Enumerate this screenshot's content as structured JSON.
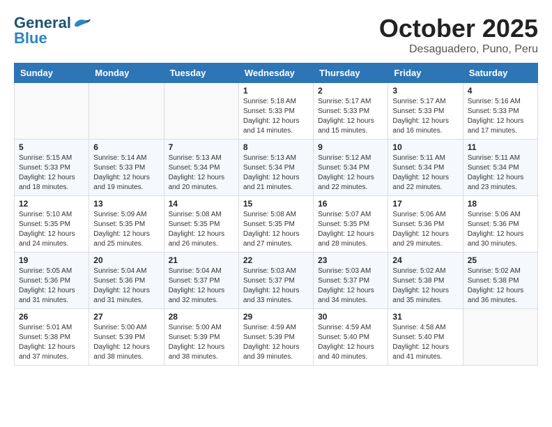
{
  "header": {
    "logo_line1": "General",
    "logo_line2": "Blue",
    "month_title": "October 2025",
    "subtitle": "Desaguadero, Puno, Peru"
  },
  "weekdays": [
    "Sunday",
    "Monday",
    "Tuesday",
    "Wednesday",
    "Thursday",
    "Friday",
    "Saturday"
  ],
  "weeks": [
    [
      {
        "day": "",
        "sunrise": "",
        "sunset": "",
        "daylight": ""
      },
      {
        "day": "",
        "sunrise": "",
        "sunset": "",
        "daylight": ""
      },
      {
        "day": "",
        "sunrise": "",
        "sunset": "",
        "daylight": ""
      },
      {
        "day": "1",
        "sunrise": "Sunrise: 5:18 AM",
        "sunset": "Sunset: 5:33 PM",
        "daylight": "Daylight: 12 hours and 14 minutes."
      },
      {
        "day": "2",
        "sunrise": "Sunrise: 5:17 AM",
        "sunset": "Sunset: 5:33 PM",
        "daylight": "Daylight: 12 hours and 15 minutes."
      },
      {
        "day": "3",
        "sunrise": "Sunrise: 5:17 AM",
        "sunset": "Sunset: 5:33 PM",
        "daylight": "Daylight: 12 hours and 16 minutes."
      },
      {
        "day": "4",
        "sunrise": "Sunrise: 5:16 AM",
        "sunset": "Sunset: 5:33 PM",
        "daylight": "Daylight: 12 hours and 17 minutes."
      }
    ],
    [
      {
        "day": "5",
        "sunrise": "Sunrise: 5:15 AM",
        "sunset": "Sunset: 5:33 PM",
        "daylight": "Daylight: 12 hours and 18 minutes."
      },
      {
        "day": "6",
        "sunrise": "Sunrise: 5:14 AM",
        "sunset": "Sunset: 5:33 PM",
        "daylight": "Daylight: 12 hours and 19 minutes."
      },
      {
        "day": "7",
        "sunrise": "Sunrise: 5:13 AM",
        "sunset": "Sunset: 5:34 PM",
        "daylight": "Daylight: 12 hours and 20 minutes."
      },
      {
        "day": "8",
        "sunrise": "Sunrise: 5:13 AM",
        "sunset": "Sunset: 5:34 PM",
        "daylight": "Daylight: 12 hours and 21 minutes."
      },
      {
        "day": "9",
        "sunrise": "Sunrise: 5:12 AM",
        "sunset": "Sunset: 5:34 PM",
        "daylight": "Daylight: 12 hours and 22 minutes."
      },
      {
        "day": "10",
        "sunrise": "Sunrise: 5:11 AM",
        "sunset": "Sunset: 5:34 PM",
        "daylight": "Daylight: 12 hours and 22 minutes."
      },
      {
        "day": "11",
        "sunrise": "Sunrise: 5:11 AM",
        "sunset": "Sunset: 5:34 PM",
        "daylight": "Daylight: 12 hours and 23 minutes."
      }
    ],
    [
      {
        "day": "12",
        "sunrise": "Sunrise: 5:10 AM",
        "sunset": "Sunset: 5:35 PM",
        "daylight": "Daylight: 12 hours and 24 minutes."
      },
      {
        "day": "13",
        "sunrise": "Sunrise: 5:09 AM",
        "sunset": "Sunset: 5:35 PM",
        "daylight": "Daylight: 12 hours and 25 minutes."
      },
      {
        "day": "14",
        "sunrise": "Sunrise: 5:08 AM",
        "sunset": "Sunset: 5:35 PM",
        "daylight": "Daylight: 12 hours and 26 minutes."
      },
      {
        "day": "15",
        "sunrise": "Sunrise: 5:08 AM",
        "sunset": "Sunset: 5:35 PM",
        "daylight": "Daylight: 12 hours and 27 minutes."
      },
      {
        "day": "16",
        "sunrise": "Sunrise: 5:07 AM",
        "sunset": "Sunset: 5:35 PM",
        "daylight": "Daylight: 12 hours and 28 minutes."
      },
      {
        "day": "17",
        "sunrise": "Sunrise: 5:06 AM",
        "sunset": "Sunset: 5:36 PM",
        "daylight": "Daylight: 12 hours and 29 minutes."
      },
      {
        "day": "18",
        "sunrise": "Sunrise: 5:06 AM",
        "sunset": "Sunset: 5:36 PM",
        "daylight": "Daylight: 12 hours and 30 minutes."
      }
    ],
    [
      {
        "day": "19",
        "sunrise": "Sunrise: 5:05 AM",
        "sunset": "Sunset: 5:36 PM",
        "daylight": "Daylight: 12 hours and 31 minutes."
      },
      {
        "day": "20",
        "sunrise": "Sunrise: 5:04 AM",
        "sunset": "Sunset: 5:36 PM",
        "daylight": "Daylight: 12 hours and 31 minutes."
      },
      {
        "day": "21",
        "sunrise": "Sunrise: 5:04 AM",
        "sunset": "Sunset: 5:37 PM",
        "daylight": "Daylight: 12 hours and 32 minutes."
      },
      {
        "day": "22",
        "sunrise": "Sunrise: 5:03 AM",
        "sunset": "Sunset: 5:37 PM",
        "daylight": "Daylight: 12 hours and 33 minutes."
      },
      {
        "day": "23",
        "sunrise": "Sunrise: 5:03 AM",
        "sunset": "Sunset: 5:37 PM",
        "daylight": "Daylight: 12 hours and 34 minutes."
      },
      {
        "day": "24",
        "sunrise": "Sunrise: 5:02 AM",
        "sunset": "Sunset: 5:38 PM",
        "daylight": "Daylight: 12 hours and 35 minutes."
      },
      {
        "day": "25",
        "sunrise": "Sunrise: 5:02 AM",
        "sunset": "Sunset: 5:38 PM",
        "daylight": "Daylight: 12 hours and 36 minutes."
      }
    ],
    [
      {
        "day": "26",
        "sunrise": "Sunrise: 5:01 AM",
        "sunset": "Sunset: 5:38 PM",
        "daylight": "Daylight: 12 hours and 37 minutes."
      },
      {
        "day": "27",
        "sunrise": "Sunrise: 5:00 AM",
        "sunset": "Sunset: 5:39 PM",
        "daylight": "Daylight: 12 hours and 38 minutes."
      },
      {
        "day": "28",
        "sunrise": "Sunrise: 5:00 AM",
        "sunset": "Sunset: 5:39 PM",
        "daylight": "Daylight: 12 hours and 38 minutes."
      },
      {
        "day": "29",
        "sunrise": "Sunrise: 4:59 AM",
        "sunset": "Sunset: 5:39 PM",
        "daylight": "Daylight: 12 hours and 39 minutes."
      },
      {
        "day": "30",
        "sunrise": "Sunrise: 4:59 AM",
        "sunset": "Sunset: 5:40 PM",
        "daylight": "Daylight: 12 hours and 40 minutes."
      },
      {
        "day": "31",
        "sunrise": "Sunrise: 4:58 AM",
        "sunset": "Sunset: 5:40 PM",
        "daylight": "Daylight: 12 hours and 41 minutes."
      },
      {
        "day": "",
        "sunrise": "",
        "sunset": "",
        "daylight": ""
      }
    ]
  ]
}
